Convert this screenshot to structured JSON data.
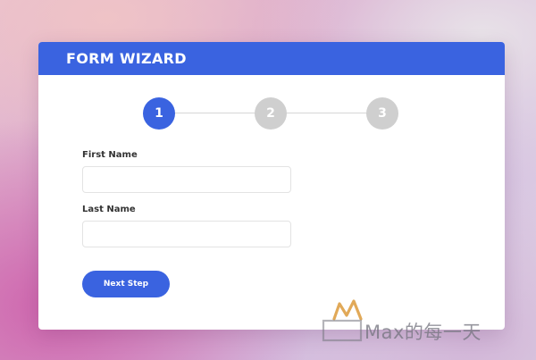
{
  "form": {
    "title": "FORM WIZARD",
    "steps": [
      {
        "label": "1",
        "state": "active"
      },
      {
        "label": "2",
        "state": "inactive"
      },
      {
        "label": "3",
        "state": "inactive"
      }
    ],
    "first_name": {
      "label": "First Name",
      "value": "",
      "placeholder": ""
    },
    "last_name": {
      "label": "Last Name",
      "value": "",
      "placeholder": ""
    },
    "next_button_label": "Next Step"
  },
  "colors": {
    "accent": "#3a63e0",
    "step_inactive": "#cfcfcf",
    "card_background": "#ffffff"
  },
  "watermark": {
    "text": "Max的每一天"
  }
}
